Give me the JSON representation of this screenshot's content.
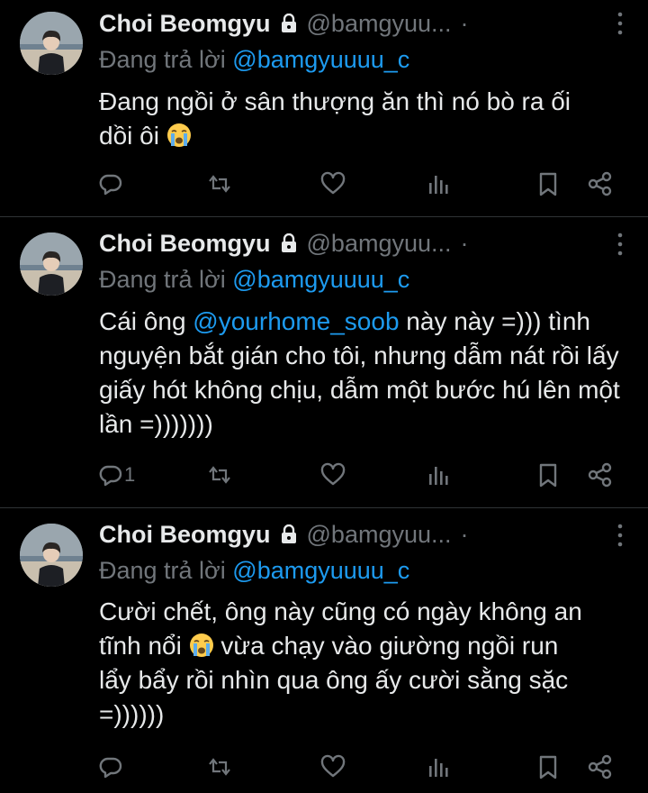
{
  "colors": {
    "background": "#000000",
    "text": "#e7e9ea",
    "muted": "#71767b",
    "link": "#1d9bf0",
    "divider": "#2f3336"
  },
  "tweets": [
    {
      "display_name": "Choi Beomgyu",
      "handle": "@bamgyuu...",
      "separator": "·",
      "reply_prefix": "Đang trả lời",
      "reply_to": "@bamgyuuuu_c",
      "body_1": "Đang ngồi ở sân thượng ăn thì nó bò ra ối",
      "body_2": "dồi ôi",
      "emoji": "loudly-crying-face",
      "reply_count": "",
      "icons": [
        "reply-icon",
        "retweet-icon",
        "like-icon",
        "views-icon",
        "bookmark-icon",
        "share-icon"
      ]
    },
    {
      "display_name": "Choi Beomgyu",
      "handle": "@bamgyuu...",
      "separator": "·",
      "reply_prefix": "Đang trả lời",
      "reply_to": "@bamgyuuuu_c",
      "body_pre": "Cái ông ",
      "body_mention": "@yourhome_soob",
      "body_post": " này này =))) tình nguyện bắt gián cho tôi, nhưng dẫm nát rồi lấy giấy hót không chịu, dẫm một bước hú lên một lần =)))))))",
      "reply_count": "1",
      "icons": [
        "reply-icon",
        "retweet-icon",
        "like-icon",
        "views-icon",
        "bookmark-icon",
        "share-icon"
      ]
    },
    {
      "display_name": "Choi Beomgyu",
      "handle": "@bamgyuu...",
      "separator": "·",
      "reply_prefix": "Đang trả lời",
      "reply_to": "@bamgyuuuu_c",
      "body_1": "Cười chết, ông này cũng có ngày không an",
      "body_2a": "tĩnh nổi",
      "body_2b": " vừa chạy vào giường ngồi run",
      "body_3": "lẩy bẩy rồi nhìn qua ông ấy cười sằng sặc",
      "body_4": "=))))))",
      "emoji": "loudly-crying-face",
      "reply_count": "",
      "icons": [
        "reply-icon",
        "retweet-icon",
        "like-icon",
        "views-icon",
        "bookmark-icon",
        "share-icon"
      ]
    }
  ]
}
